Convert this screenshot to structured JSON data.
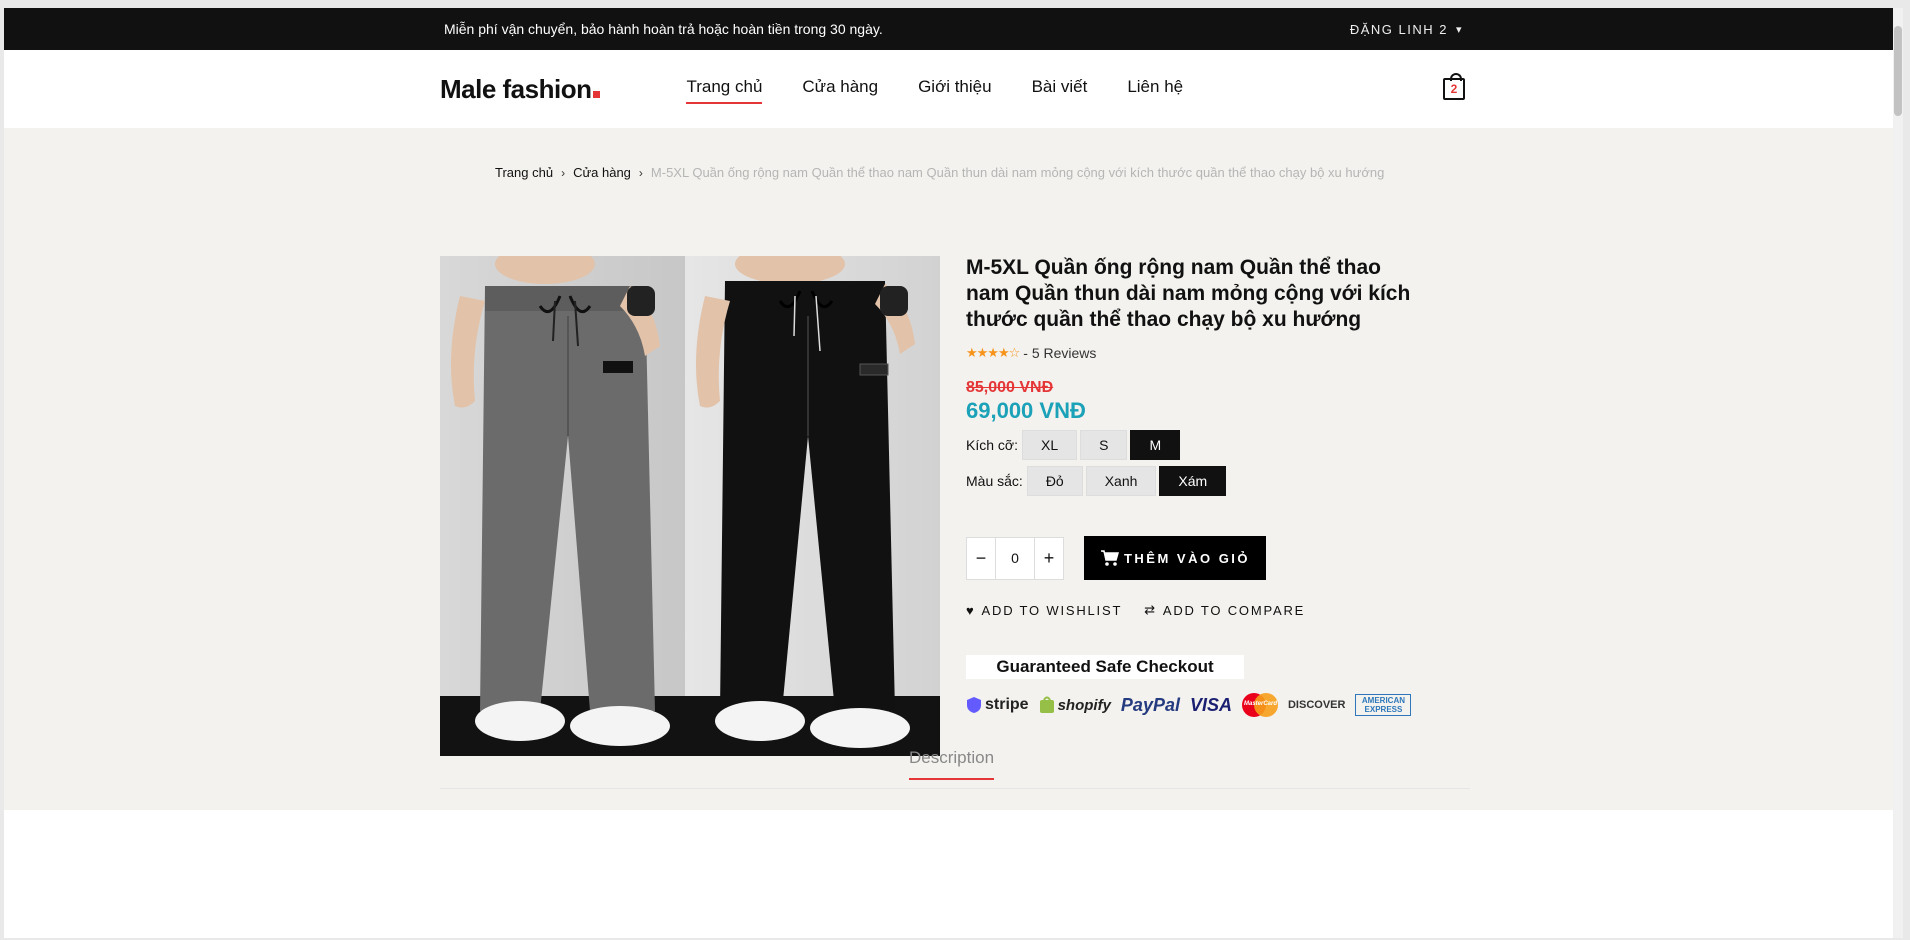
{
  "topbar": {
    "notice": "Miễn phí vận chuyển, bảo hành hoàn trả hoặc hoàn tiền trong 30 ngày.",
    "account": "ĐẶNG LINH 2"
  },
  "header": {
    "logo_main": "Male fashion",
    "nav": [
      {
        "label": "Trang chủ"
      },
      {
        "label": "Cửa hàng"
      },
      {
        "label": "Giới thiệu"
      },
      {
        "label": "Bài viết"
      },
      {
        "label": "Liên hệ"
      }
    ],
    "cart_count": "2"
  },
  "breadcrumb": {
    "home": "Trang chủ",
    "shop": "Cửa hàng",
    "current": "M-5XL Quần ống rộng nam Quần thể thao nam Quần thun dài nam mỏng cộng với kích thước quần thể thao chạy bộ xu hướng"
  },
  "product": {
    "title": "M-5XL Quần ống rộng nam Quần thể thao nam Quần thun dài nam mỏng cộng với kích thước quần thể thao chạy bộ xu hướng",
    "reviews": "- 5 Reviews",
    "rating": 4,
    "old_price": "85,000 VNĐ",
    "new_price": "69,000 VNĐ",
    "size_label": "Kích cỡ:",
    "sizes": [
      "XL",
      "S",
      "M"
    ],
    "selected_size": "M",
    "color_label": "Màu sắc:",
    "colors": [
      "Đỏ",
      "Xanh",
      "Xám"
    ],
    "selected_color": "Xám",
    "quantity": "0",
    "add_to_cart": "THÊM VÀO GIỎ",
    "wishlist": "ADD TO WISHLIST",
    "compare": "ADD TO COMPARE",
    "safe_checkout": "Guaranteed Safe Checkout"
  },
  "payments": [
    "stripe",
    "shopify",
    "PayPal",
    "VISA",
    "MasterCard",
    "DISCOVER",
    "AMERICAN EXPRESS"
  ],
  "tabs": {
    "description": "Description"
  }
}
